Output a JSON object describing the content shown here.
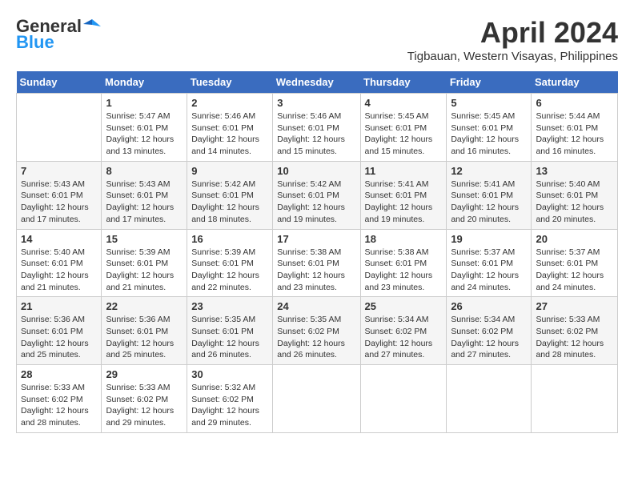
{
  "logo": {
    "general": "General",
    "blue": "Blue"
  },
  "header": {
    "month": "April 2024",
    "location": "Tigbauan, Western Visayas, Philippines"
  },
  "weekdays": [
    "Sunday",
    "Monday",
    "Tuesday",
    "Wednesday",
    "Thursday",
    "Friday",
    "Saturday"
  ],
  "weeks": [
    [
      {
        "day": "",
        "sunrise": "",
        "sunset": "",
        "daylight": ""
      },
      {
        "day": "1",
        "sunrise": "Sunrise: 5:47 AM",
        "sunset": "Sunset: 6:01 PM",
        "daylight": "Daylight: 12 hours and 13 minutes."
      },
      {
        "day": "2",
        "sunrise": "Sunrise: 5:46 AM",
        "sunset": "Sunset: 6:01 PM",
        "daylight": "Daylight: 12 hours and 14 minutes."
      },
      {
        "day": "3",
        "sunrise": "Sunrise: 5:46 AM",
        "sunset": "Sunset: 6:01 PM",
        "daylight": "Daylight: 12 hours and 15 minutes."
      },
      {
        "day": "4",
        "sunrise": "Sunrise: 5:45 AM",
        "sunset": "Sunset: 6:01 PM",
        "daylight": "Daylight: 12 hours and 15 minutes."
      },
      {
        "day": "5",
        "sunrise": "Sunrise: 5:45 AM",
        "sunset": "Sunset: 6:01 PM",
        "daylight": "Daylight: 12 hours and 16 minutes."
      },
      {
        "day": "6",
        "sunrise": "Sunrise: 5:44 AM",
        "sunset": "Sunset: 6:01 PM",
        "daylight": "Daylight: 12 hours and 16 minutes."
      }
    ],
    [
      {
        "day": "7",
        "sunrise": "Sunrise: 5:43 AM",
        "sunset": "Sunset: 6:01 PM",
        "daylight": "Daylight: 12 hours and 17 minutes."
      },
      {
        "day": "8",
        "sunrise": "Sunrise: 5:43 AM",
        "sunset": "Sunset: 6:01 PM",
        "daylight": "Daylight: 12 hours and 17 minutes."
      },
      {
        "day": "9",
        "sunrise": "Sunrise: 5:42 AM",
        "sunset": "Sunset: 6:01 PM",
        "daylight": "Daylight: 12 hours and 18 minutes."
      },
      {
        "day": "10",
        "sunrise": "Sunrise: 5:42 AM",
        "sunset": "Sunset: 6:01 PM",
        "daylight": "Daylight: 12 hours and 19 minutes."
      },
      {
        "day": "11",
        "sunrise": "Sunrise: 5:41 AM",
        "sunset": "Sunset: 6:01 PM",
        "daylight": "Daylight: 12 hours and 19 minutes."
      },
      {
        "day": "12",
        "sunrise": "Sunrise: 5:41 AM",
        "sunset": "Sunset: 6:01 PM",
        "daylight": "Daylight: 12 hours and 20 minutes."
      },
      {
        "day": "13",
        "sunrise": "Sunrise: 5:40 AM",
        "sunset": "Sunset: 6:01 PM",
        "daylight": "Daylight: 12 hours and 20 minutes."
      }
    ],
    [
      {
        "day": "14",
        "sunrise": "Sunrise: 5:40 AM",
        "sunset": "Sunset: 6:01 PM",
        "daylight": "Daylight: 12 hours and 21 minutes."
      },
      {
        "day": "15",
        "sunrise": "Sunrise: 5:39 AM",
        "sunset": "Sunset: 6:01 PM",
        "daylight": "Daylight: 12 hours and 21 minutes."
      },
      {
        "day": "16",
        "sunrise": "Sunrise: 5:39 AM",
        "sunset": "Sunset: 6:01 PM",
        "daylight": "Daylight: 12 hours and 22 minutes."
      },
      {
        "day": "17",
        "sunrise": "Sunrise: 5:38 AM",
        "sunset": "Sunset: 6:01 PM",
        "daylight": "Daylight: 12 hours and 23 minutes."
      },
      {
        "day": "18",
        "sunrise": "Sunrise: 5:38 AM",
        "sunset": "Sunset: 6:01 PM",
        "daylight": "Daylight: 12 hours and 23 minutes."
      },
      {
        "day": "19",
        "sunrise": "Sunrise: 5:37 AM",
        "sunset": "Sunset: 6:01 PM",
        "daylight": "Daylight: 12 hours and 24 minutes."
      },
      {
        "day": "20",
        "sunrise": "Sunrise: 5:37 AM",
        "sunset": "Sunset: 6:01 PM",
        "daylight": "Daylight: 12 hours and 24 minutes."
      }
    ],
    [
      {
        "day": "21",
        "sunrise": "Sunrise: 5:36 AM",
        "sunset": "Sunset: 6:01 PM",
        "daylight": "Daylight: 12 hours and 25 minutes."
      },
      {
        "day": "22",
        "sunrise": "Sunrise: 5:36 AM",
        "sunset": "Sunset: 6:01 PM",
        "daylight": "Daylight: 12 hours and 25 minutes."
      },
      {
        "day": "23",
        "sunrise": "Sunrise: 5:35 AM",
        "sunset": "Sunset: 6:01 PM",
        "daylight": "Daylight: 12 hours and 26 minutes."
      },
      {
        "day": "24",
        "sunrise": "Sunrise: 5:35 AM",
        "sunset": "Sunset: 6:02 PM",
        "daylight": "Daylight: 12 hours and 26 minutes."
      },
      {
        "day": "25",
        "sunrise": "Sunrise: 5:34 AM",
        "sunset": "Sunset: 6:02 PM",
        "daylight": "Daylight: 12 hours and 27 minutes."
      },
      {
        "day": "26",
        "sunrise": "Sunrise: 5:34 AM",
        "sunset": "Sunset: 6:02 PM",
        "daylight": "Daylight: 12 hours and 27 minutes."
      },
      {
        "day": "27",
        "sunrise": "Sunrise: 5:33 AM",
        "sunset": "Sunset: 6:02 PM",
        "daylight": "Daylight: 12 hours and 28 minutes."
      }
    ],
    [
      {
        "day": "28",
        "sunrise": "Sunrise: 5:33 AM",
        "sunset": "Sunset: 6:02 PM",
        "daylight": "Daylight: 12 hours and 28 minutes."
      },
      {
        "day": "29",
        "sunrise": "Sunrise: 5:33 AM",
        "sunset": "Sunset: 6:02 PM",
        "daylight": "Daylight: 12 hours and 29 minutes."
      },
      {
        "day": "30",
        "sunrise": "Sunrise: 5:32 AM",
        "sunset": "Sunset: 6:02 PM",
        "daylight": "Daylight: 12 hours and 29 minutes."
      },
      {
        "day": "",
        "sunrise": "",
        "sunset": "",
        "daylight": ""
      },
      {
        "day": "",
        "sunrise": "",
        "sunset": "",
        "daylight": ""
      },
      {
        "day": "",
        "sunrise": "",
        "sunset": "",
        "daylight": ""
      },
      {
        "day": "",
        "sunrise": "",
        "sunset": "",
        "daylight": ""
      }
    ]
  ]
}
